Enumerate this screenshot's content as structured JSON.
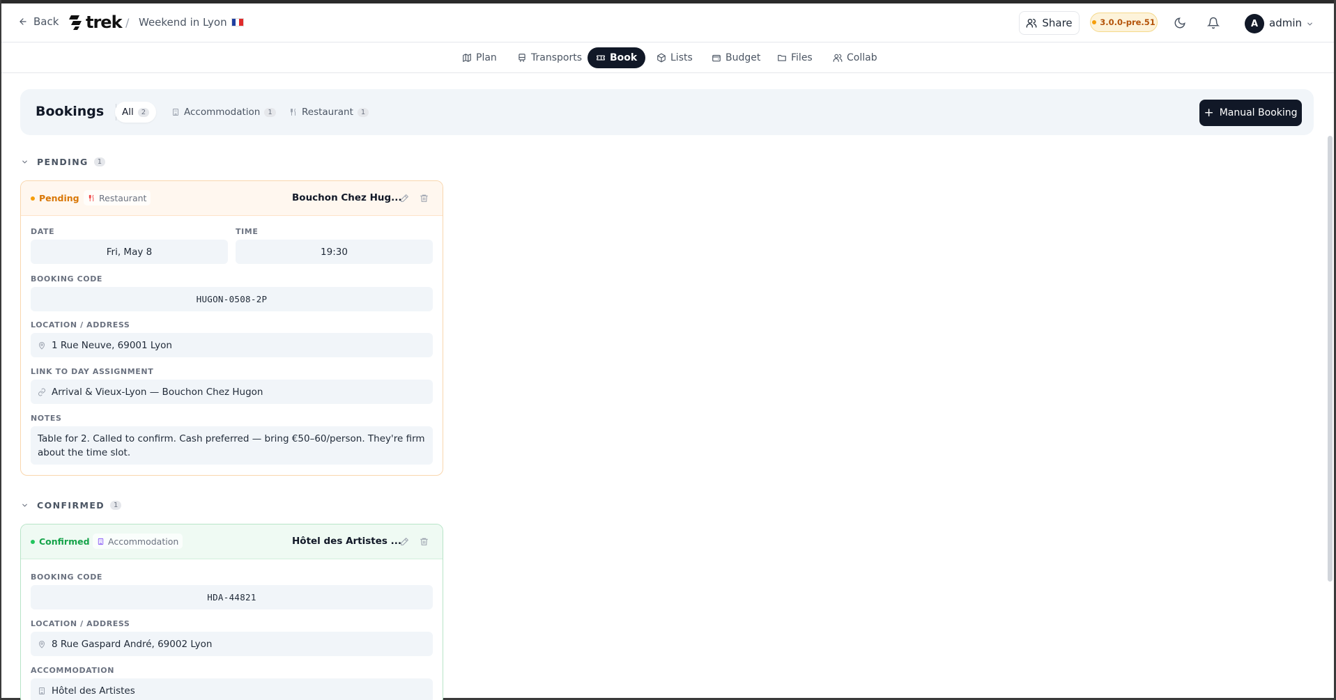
{
  "header": {
    "back_label": "Back",
    "brand": "trek",
    "separator": "/",
    "trip_title": "Weekend in Lyon",
    "share_label": "Share",
    "version": "3.0.0-pre.51",
    "avatar_initial": "A",
    "username": "admin"
  },
  "tabs": [
    {
      "label": "Plan",
      "icon": "map-icon",
      "active": false
    },
    {
      "label": "Transports",
      "icon": "train-icon",
      "active": false
    },
    {
      "label": "Book",
      "icon": "ticket-icon",
      "active": true
    },
    {
      "label": "Lists",
      "icon": "package-icon",
      "active": false
    },
    {
      "label": "Budget",
      "icon": "wallet-icon",
      "active": false
    },
    {
      "label": "Files",
      "icon": "folder-icon",
      "active": false
    },
    {
      "label": "Collab",
      "icon": "users-icon",
      "active": false
    }
  ],
  "bookings": {
    "title": "Bookings",
    "filters": [
      {
        "label": "All",
        "count": "2",
        "active": true
      },
      {
        "label": "Accommodation",
        "count": "1",
        "active": false
      },
      {
        "label": "Restaurant",
        "count": "1",
        "active": false
      }
    ],
    "manual_button": "Manual Booking"
  },
  "sections": {
    "pending": {
      "label": "PENDING",
      "count": "1",
      "card": {
        "status": "Pending",
        "type": "Restaurant",
        "title": "Bouchon Chez Hug...",
        "date_label": "DATE",
        "date": "Fri, May 8",
        "time_label": "TIME",
        "time": "19:30",
        "code_label": "BOOKING CODE",
        "code": "HUGON-0508-2P",
        "location_label": "LOCATION / ADDRESS",
        "location": "1 Rue Neuve, 69001 Lyon",
        "link_label": "LINK TO DAY ASSIGNMENT",
        "link": "Arrival & Vieux-Lyon — Bouchon Chez Hugon",
        "notes_label": "NOTES",
        "notes": "Table for 2. Called to confirm. Cash preferred — bring €50–60/person. They're firm about the time slot."
      }
    },
    "confirmed": {
      "label": "CONFIRMED",
      "count": "1",
      "card": {
        "status": "Confirmed",
        "type": "Accommodation",
        "title": "Hôtel des Artistes ...",
        "code_label": "BOOKING CODE",
        "code": "HDA-44821",
        "location_label": "LOCATION / ADDRESS",
        "location": "8 Rue Gaspard André, 69002 Lyon",
        "accommodation_label": "ACCOMMODATION",
        "accommodation": "Hôtel des Artistes"
      }
    }
  },
  "colors": {
    "primary": "#111827",
    "pending": "#d97706",
    "confirmed": "#16a34a",
    "version_badge": "#b45309"
  }
}
